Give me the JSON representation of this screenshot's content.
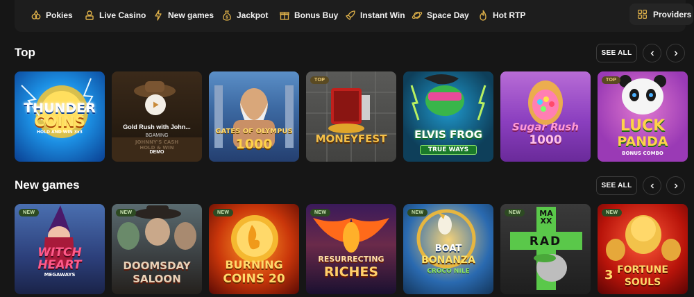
{
  "nav": {
    "items": [
      {
        "label": "Pokies",
        "icon": "pokies-icon"
      },
      {
        "label": "Live Casino",
        "icon": "live-casino-icon"
      },
      {
        "label": "New games",
        "icon": "lightning-icon"
      },
      {
        "label": "Jackpot",
        "icon": "money-bag-icon"
      },
      {
        "label": "Bonus Buy",
        "icon": "gift-icon"
      },
      {
        "label": "Instant Win",
        "icon": "rocket-icon"
      },
      {
        "label": "Space Day",
        "icon": "planet-icon"
      },
      {
        "label": "Hot RTP",
        "icon": "flame-icon"
      }
    ],
    "providers_label": "Providers"
  },
  "sections": [
    {
      "title": "Top",
      "see_all": "SEE ALL",
      "games": [
        {
          "name": "Thunder Coins",
          "logo_line1": "THUNDER",
          "logo_line2": "COINS",
          "logo_line3": "HOLD AND WIN 3x3",
          "badge": ""
        },
        {
          "name": "Gold Rush with John...",
          "provider": "BGAMING",
          "action": "DEMO",
          "logo_line1": "JOHNNY'S CASH",
          "logo_line2": "HOLD & WIN",
          "badge": ""
        },
        {
          "name": "Gates of Olympus 1000",
          "logo_line1": "GATES OF OLYMPUS",
          "logo_line2": "1000",
          "badge": ""
        },
        {
          "name": "Moneyfest",
          "logo_line1": "MONEYFEST",
          "badge": "TOP"
        },
        {
          "name": "Elvis Frog TrueWays",
          "logo_line1": "ELVIS FROG",
          "logo_line2": "TRUE WAYS",
          "badge": ""
        },
        {
          "name": "Sugar Rush 1000",
          "logo_line1": "Sugar Rush",
          "logo_line2": "1000",
          "badge": ""
        },
        {
          "name": "Luck of Panda Bonus Combo",
          "logo_line1": "LUCK",
          "logo_line2": "PANDA",
          "logo_line3": "BONUS COMBO",
          "badge": "TOP"
        }
      ]
    },
    {
      "title": "New games",
      "see_all": "SEE ALL",
      "games": [
        {
          "name": "Witch Heart Megaways",
          "logo_line1": "WITCH",
          "logo_line2": "HEART",
          "logo_line3": "MEGAWAYS",
          "badge": "NEW"
        },
        {
          "name": "Doomsday Saloon",
          "logo_line1": "DOOMSDAY",
          "logo_line2": "SALOON",
          "badge": "NEW"
        },
        {
          "name": "Burning Coins 20",
          "logo_line1": "BURNING",
          "logo_line2": "COINS 20",
          "badge": "NEW"
        },
        {
          "name": "Resurrecting Riches",
          "logo_line1": "RESURRECTING",
          "logo_line2": "RICHES",
          "badge": "NEW"
        },
        {
          "name": "Boat Bonanza Croco Nile",
          "logo_line1": "BOAT",
          "logo_line2": "BONANZA",
          "logo_line3": "CROCO NILE",
          "badge": "NEW"
        },
        {
          "name": "Rad Maxx",
          "logo_line1": "RAD",
          "logo_line2": "MAXX",
          "badge": "NEW"
        },
        {
          "name": "3 Fortune Souls",
          "logo_line1": "FORTUNE",
          "logo_line2": "SOULS",
          "badge": "NEW"
        }
      ]
    }
  ],
  "colors": {
    "background": "#161616",
    "nav": "#1d1d1d",
    "accent": "#e0b24a"
  }
}
